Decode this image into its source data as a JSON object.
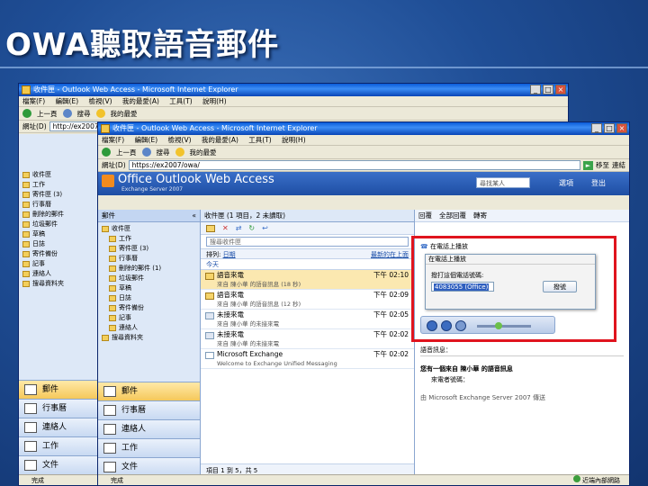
{
  "slide": {
    "title": "OWA聽取語音郵件"
  },
  "back_window": {
    "title": "收件匣 - Outlook Web Access - Microsoft Internet Explorer",
    "menu": [
      "檔案(F)",
      "編輯(E)",
      "檢視(V)",
      "我的最愛(A)",
      "工具(T)",
      "說明(H)"
    ],
    "toolbar": {
      "back": "上一頁",
      "search": "搜尋",
      "favorites": "我的最愛"
    },
    "address_label": "網址(D)",
    "address": "http://ex2007/",
    "tree": [
      "收件匣",
      "工作",
      "寄件匣 (3)",
      "行事曆",
      "刪除的郵件",
      "垃圾郵件",
      "草稿",
      "日誌",
      "寄件備份",
      "記事",
      "連絡人",
      "搜尋資料夾"
    ],
    "nav_buttons": [
      "郵件",
      "行事曆",
      "連絡人",
      "工作",
      "文件"
    ],
    "status": "完成"
  },
  "front_window": {
    "title": "收件匣 - Outlook Web Access - Microsoft Internet Explorer",
    "menu": [
      "檔案(F)",
      "編輯(E)",
      "檢視(V)",
      "我的最愛(A)",
      "工具(T)",
      "說明(H)"
    ],
    "toolbar": {
      "back": "上一頁",
      "search": "搜尋",
      "favorites": "我的最愛"
    },
    "address_label": "網址(D)",
    "address": "https://ex2007/owa/",
    "go": "移至",
    "links": "連結",
    "brand": "Office Outlook Web Access",
    "brand_sub": "Exchange Server 2007",
    "find_someone": "尋找某人",
    "options": "選項",
    "logoff": "登出",
    "nav_header": "郵件",
    "tree": [
      "收件匣",
      "工作",
      "寄件匣 (3)",
      "行事曆",
      "刪除的郵件 (1)",
      "垃圾郵件",
      "草稿",
      "日誌",
      "寄件備份",
      "記事",
      "連絡人",
      "搜尋資料夾"
    ],
    "nav_buttons": [
      "郵件",
      "行事曆",
      "連絡人",
      "工作",
      "文件"
    ],
    "list_header": "收件匣 (1 項目，2 未讀取)",
    "search_placeholder": "搜尋收件匣",
    "arrange_by": "排列",
    "arrange_field": "日期",
    "newest_top": "最新的在上面",
    "day_label": "今天",
    "messages": [
      {
        "sender": "語音來電",
        "time": "下午 02:10",
        "preview": "來自 陳小華 的語音訊息 (18 秒)",
        "selected": true
      },
      {
        "sender": "語音來電",
        "time": "下午 02:09",
        "preview": "來自 陳小華 的語音訊息 (12 秒)",
        "selected": false
      },
      {
        "sender": "未接來電",
        "time": "下午 02:05",
        "preview": "來自 陳小華 的未接來電",
        "selected": false
      },
      {
        "sender": "未接來電",
        "time": "下午 02:02",
        "preview": "來自 陳小華 的未接來電",
        "selected": false
      },
      {
        "sender": "Microsoft Exchange",
        "time": "下午 02:02",
        "preview": "Welcome to Exchange Unified Messaging",
        "selected": false
      }
    ],
    "list_footer": "項目 1 到 5，共 5",
    "read_toolbar": [
      "回覆",
      "全部回覆",
      "轉寄"
    ],
    "play_on_phone": "在電話上播放",
    "dialog": {
      "title": "在電話上播放",
      "label": "撥打這個電話號碼:",
      "input": "4083055 (Office)",
      "button": "撥號"
    },
    "read_lines": [
      "語音訊息：",
      "您有一個來自 陳小華 的語音訊息",
      "來電者號碼：",
      "由 Microsoft Exchange Server 2007 傳送"
    ],
    "status": "完成",
    "status_zone": "近端內部網路"
  },
  "colors": {
    "highlight": "#e0141e",
    "selected_row": "#fbe8b0"
  }
}
